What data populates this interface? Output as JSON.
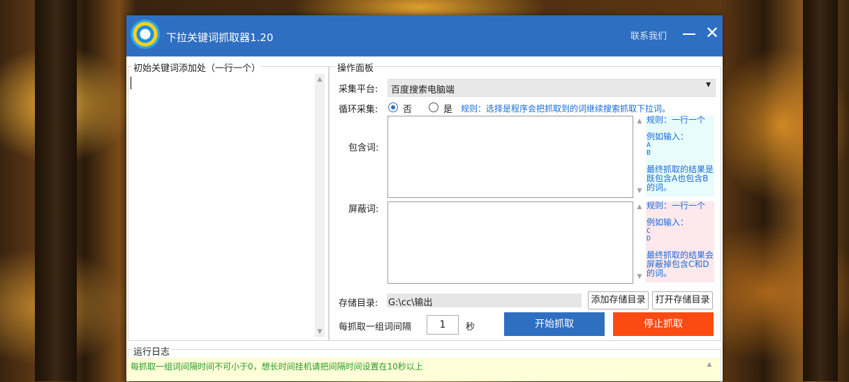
{
  "window": {
    "title": "下拉关键词抓取器1.20",
    "contact_label": "联系我们",
    "minimize_icon": "minimize-icon",
    "close_icon": "close-icon",
    "close_glyph": "✕"
  },
  "keywords_panel": {
    "label": "初始关键词添加处（一行一个）"
  },
  "operation_panel": {
    "label": "操作面板",
    "platform_label": "采集平台:",
    "platform_value": "百度搜索电脑端",
    "loop_label": "循环采集:",
    "loop_options": [
      "否",
      "是"
    ],
    "loop_selected": "否",
    "loop_rule": "规则：选择是程序会把抓取到的词继续搜索抓取下拉词。",
    "include_label": "包含词:",
    "include_hint": {
      "rule": "规则：一行一个",
      "example": "例如输入：",
      "sample1": "A",
      "sample2": "B",
      "result": "最终抓取的结果是既包含A也包含B的词。"
    },
    "exclude_label": "屏蔽词:",
    "exclude_hint": {
      "rule": "规则：一行一个",
      "example": "例如输入：",
      "sample1": "C",
      "sample2": "D",
      "result": "最终抓取的结果会屏蔽掉包含C和D的词。"
    },
    "save_dir_label": "存储目录:",
    "save_dir_value": "G:\\cc\\输出",
    "add_dir_button": "添加存储目录",
    "open_dir_button": "打开存储目录",
    "interval_label": "每抓取一组词间隔",
    "interval_value": "1",
    "interval_unit": "秒",
    "start_button": "开始抓取",
    "stop_button": "停止抓取",
    "colors": {
      "start": "#2f6fc2",
      "stop": "#fc4b12",
      "titlebar": "#2f6fc2"
    }
  },
  "log_panel": {
    "label": "运行日志",
    "message": "每抓取一组词间隔时间不可小于0，想长时间挂机请把间隔时间设置在10秒以上"
  }
}
